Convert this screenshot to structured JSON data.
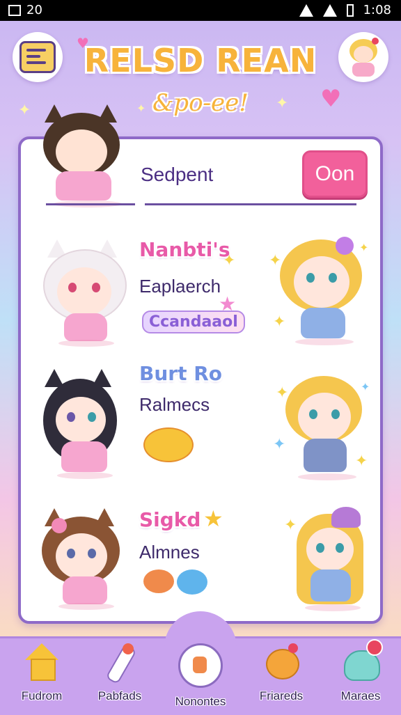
{
  "status_bar": {
    "time": "1:08",
    "left_text": "20"
  },
  "header": {
    "title": "RELSD REAN",
    "subtitle": "&po-ee!"
  },
  "search": {
    "placeholder": "Sedpent",
    "button_label": "Oon"
  },
  "rows": [
    {
      "title": "Nanbti's",
      "subtitle": "Eaplaerch",
      "chip": "Ccandaaol"
    },
    {
      "title": "Burt Ro",
      "subtitle": "Ralmecs"
    },
    {
      "title": "Sigkd",
      "subtitle": "Almnes"
    }
  ],
  "bottom_nav": [
    {
      "label": "Fudrom",
      "icon": "home-icon"
    },
    {
      "label": "Pabfads",
      "icon": "tools-icon"
    },
    {
      "label": "Nonontes",
      "icon": "potion-icon"
    },
    {
      "label": "Friareds",
      "icon": "bear-friends-icon"
    },
    {
      "label": "Maraes",
      "icon": "blob-messages-icon",
      "badge": ""
    }
  ],
  "colors": {
    "accent_pink": "#f2609b",
    "panel_border": "#8e6ac8",
    "nav_bg": "#c9a3ee",
    "title_yellow": "#f7b33b"
  }
}
